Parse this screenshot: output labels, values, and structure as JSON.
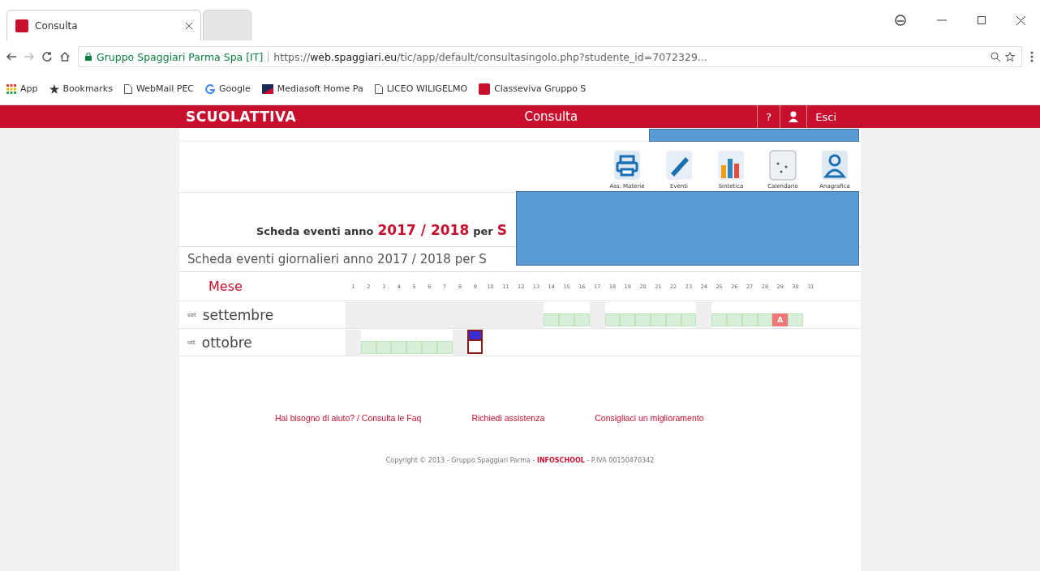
{
  "browser": {
    "tabs": [
      {
        "title": "Consulta",
        "selected": true
      },
      {
        "selected": false
      }
    ],
    "site_identity": "Gruppo Spaggiari Parma Spa [IT]",
    "url_prefix": "https://",
    "url_domain": "web.spaggiari.eu",
    "url_path": "/tic/app/default/consultasingolo.php?studente_id=7072329...",
    "bookmarks": [
      {
        "label": "App"
      },
      {
        "label": "Bookmarks"
      },
      {
        "label": "WebMail PEC"
      },
      {
        "label": "Google"
      },
      {
        "label": "Mediasoft Home Pa"
      },
      {
        "label": "LICEO WILIGELMO"
      },
      {
        "label": "Classeviva Gruppo S"
      }
    ]
  },
  "header": {
    "logo": "SCUOLATTIVA",
    "title": "Consulta",
    "help": "?",
    "logout": "Esci"
  },
  "toolbar": [
    {
      "label": "Ass. Materie"
    },
    {
      "label": "Eventi"
    },
    {
      "label": "Sintetica"
    },
    {
      "label": "Calendario"
    },
    {
      "label": "Anagrafica"
    }
  ],
  "title": {
    "prefix": "Scheda eventi anno",
    "year": "2017 / 2018",
    "per": "per",
    "name": "S"
  },
  "subtitle": "Scheda eventi giornalieri anno 2017 / 2018 per S",
  "calendar": {
    "month_header": "Mese",
    "day_labels": [
      "1",
      "2",
      "3",
      "4",
      "5",
      "6",
      "7",
      "8",
      "9",
      "10",
      "11",
      "12",
      "13",
      "14",
      "15",
      "16",
      "17",
      "18",
      "19",
      "20",
      "21",
      "22",
      "23",
      "24",
      "25",
      "26",
      "27",
      "28",
      "29",
      "30",
      "31"
    ],
    "months": [
      {
        "abbr": "set",
        "name": "settembre",
        "days": [
          {
            "kind": "off"
          },
          {
            "kind": "off"
          },
          {
            "kind": "off"
          },
          {
            "kind": "off"
          },
          {
            "kind": "off"
          },
          {
            "kind": "off"
          },
          {
            "kind": "off"
          },
          {
            "kind": "off"
          },
          {
            "kind": "off"
          },
          {
            "kind": "off"
          },
          {
            "kind": "off"
          },
          {
            "kind": "off"
          },
          {
            "kind": "off"
          },
          {
            "kind": "present"
          },
          {
            "kind": "present"
          },
          {
            "kind": "present"
          },
          {
            "kind": "off"
          },
          {
            "kind": "present"
          },
          {
            "kind": "present"
          },
          {
            "kind": "present"
          },
          {
            "kind": "present"
          },
          {
            "kind": "present"
          },
          {
            "kind": "present"
          },
          {
            "kind": "off"
          },
          {
            "kind": "present"
          },
          {
            "kind": "present"
          },
          {
            "kind": "present"
          },
          {
            "kind": "present"
          },
          {
            "kind": "absent",
            "label": "A"
          },
          {
            "kind": "present"
          },
          {
            "kind": "none"
          }
        ]
      },
      {
        "abbr": "ott",
        "name": "ottobre",
        "days": [
          {
            "kind": "off"
          },
          {
            "kind": "present"
          },
          {
            "kind": "present"
          },
          {
            "kind": "present"
          },
          {
            "kind": "present"
          },
          {
            "kind": "present"
          },
          {
            "kind": "present"
          },
          {
            "kind": "off"
          },
          {
            "kind": "event"
          },
          {
            "kind": "none"
          },
          {
            "kind": "none"
          },
          {
            "kind": "none"
          },
          {
            "kind": "none"
          },
          {
            "kind": "none"
          },
          {
            "kind": "none"
          },
          {
            "kind": "none"
          },
          {
            "kind": "none"
          },
          {
            "kind": "none"
          },
          {
            "kind": "none"
          },
          {
            "kind": "none"
          },
          {
            "kind": "none"
          },
          {
            "kind": "none"
          },
          {
            "kind": "none"
          },
          {
            "kind": "none"
          },
          {
            "kind": "none"
          },
          {
            "kind": "none"
          },
          {
            "kind": "none"
          },
          {
            "kind": "none"
          },
          {
            "kind": "none"
          },
          {
            "kind": "none"
          },
          {
            "kind": "none"
          }
        ]
      }
    ]
  },
  "footer": {
    "links": [
      "Hai bisogno di aiuto? / Consulta le Faq",
      "Richiedi assistenza",
      "Consigliaci un miglioramento"
    ],
    "copyright_prefix": "Copyright © 2013 - Gruppo Spaggiari Parma -",
    "brand": "INFOSCHOOL",
    "copyright_suffix": "- P.IVA 00150470342"
  }
}
